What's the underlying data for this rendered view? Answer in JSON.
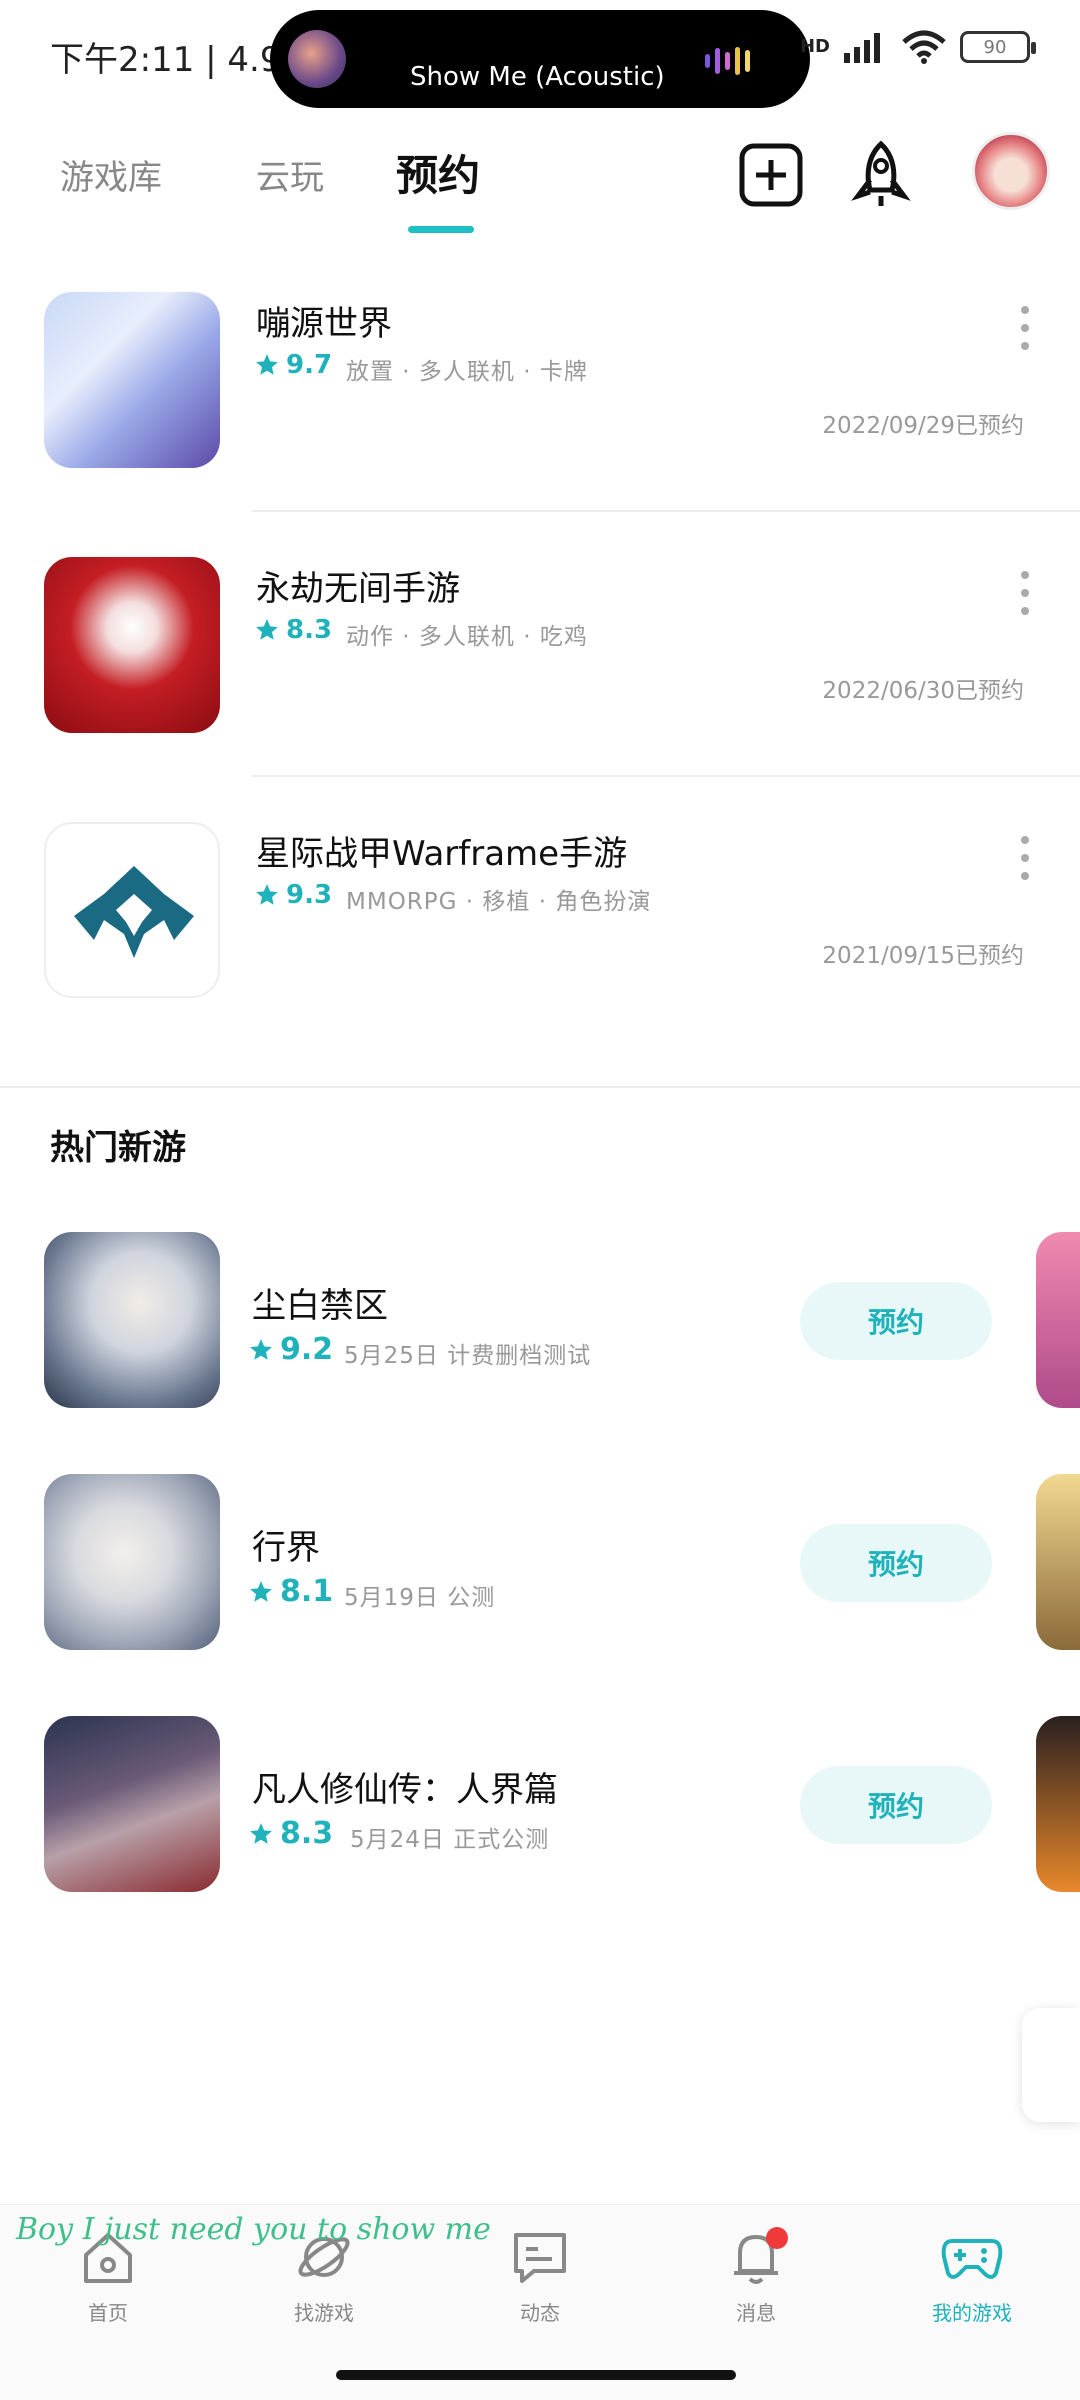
{
  "status_bar": {
    "time": "下午2:11 | 4.9K/",
    "now_playing": "Show Me (Acoustic)",
    "network": "HD",
    "battery": "90"
  },
  "top_tabs": [
    {
      "label": "游戏库",
      "active": false
    },
    {
      "label": "云玩",
      "active": false
    },
    {
      "label": "预约",
      "active": true
    }
  ],
  "reserved_games": [
    {
      "name": "嘣源世界",
      "rating": "9.7",
      "tags": "放置 · 多人联机 · 卡牌",
      "reserved": "2022/09/29已预约"
    },
    {
      "name": "永劫无间手游",
      "rating": "8.3",
      "tags": "动作 · 多人联机 · 吃鸡",
      "reserved": "2022/06/30已预约"
    },
    {
      "name": "星际战甲Warframe手游",
      "rating": "9.3",
      "tags": "MMORPG · 移植 · 角色扮演",
      "reserved": "2021/09/15已预约"
    }
  ],
  "hot_section_title": "热门新游",
  "hot_games": [
    {
      "name": "尘白禁区",
      "rating": "9.2",
      "info": "5月25日 计费删档测试",
      "button": "预约"
    },
    {
      "name": "行界",
      "rating": "8.1",
      "info": "5月19日 公测",
      "button": "预约"
    },
    {
      "name": "凡人修仙传：人界篇",
      "rating": "8.3",
      "info": "5月24日 正式公测",
      "button": "预约"
    }
  ],
  "lyric": "Boy I just need you to show me",
  "bottom_nav": [
    {
      "label": "首页",
      "icon": "home-icon"
    },
    {
      "label": "找游戏",
      "icon": "planet-icon"
    },
    {
      "label": "动态",
      "icon": "chat-icon"
    },
    {
      "label": "消息",
      "icon": "bell-icon"
    },
    {
      "label": "我的游戏",
      "icon": "gamepad-icon"
    }
  ],
  "colors": {
    "accent": "#1fb2bb",
    "badge": "#ee3a3a",
    "reserve_button_bg": "#e8f8f9"
  }
}
